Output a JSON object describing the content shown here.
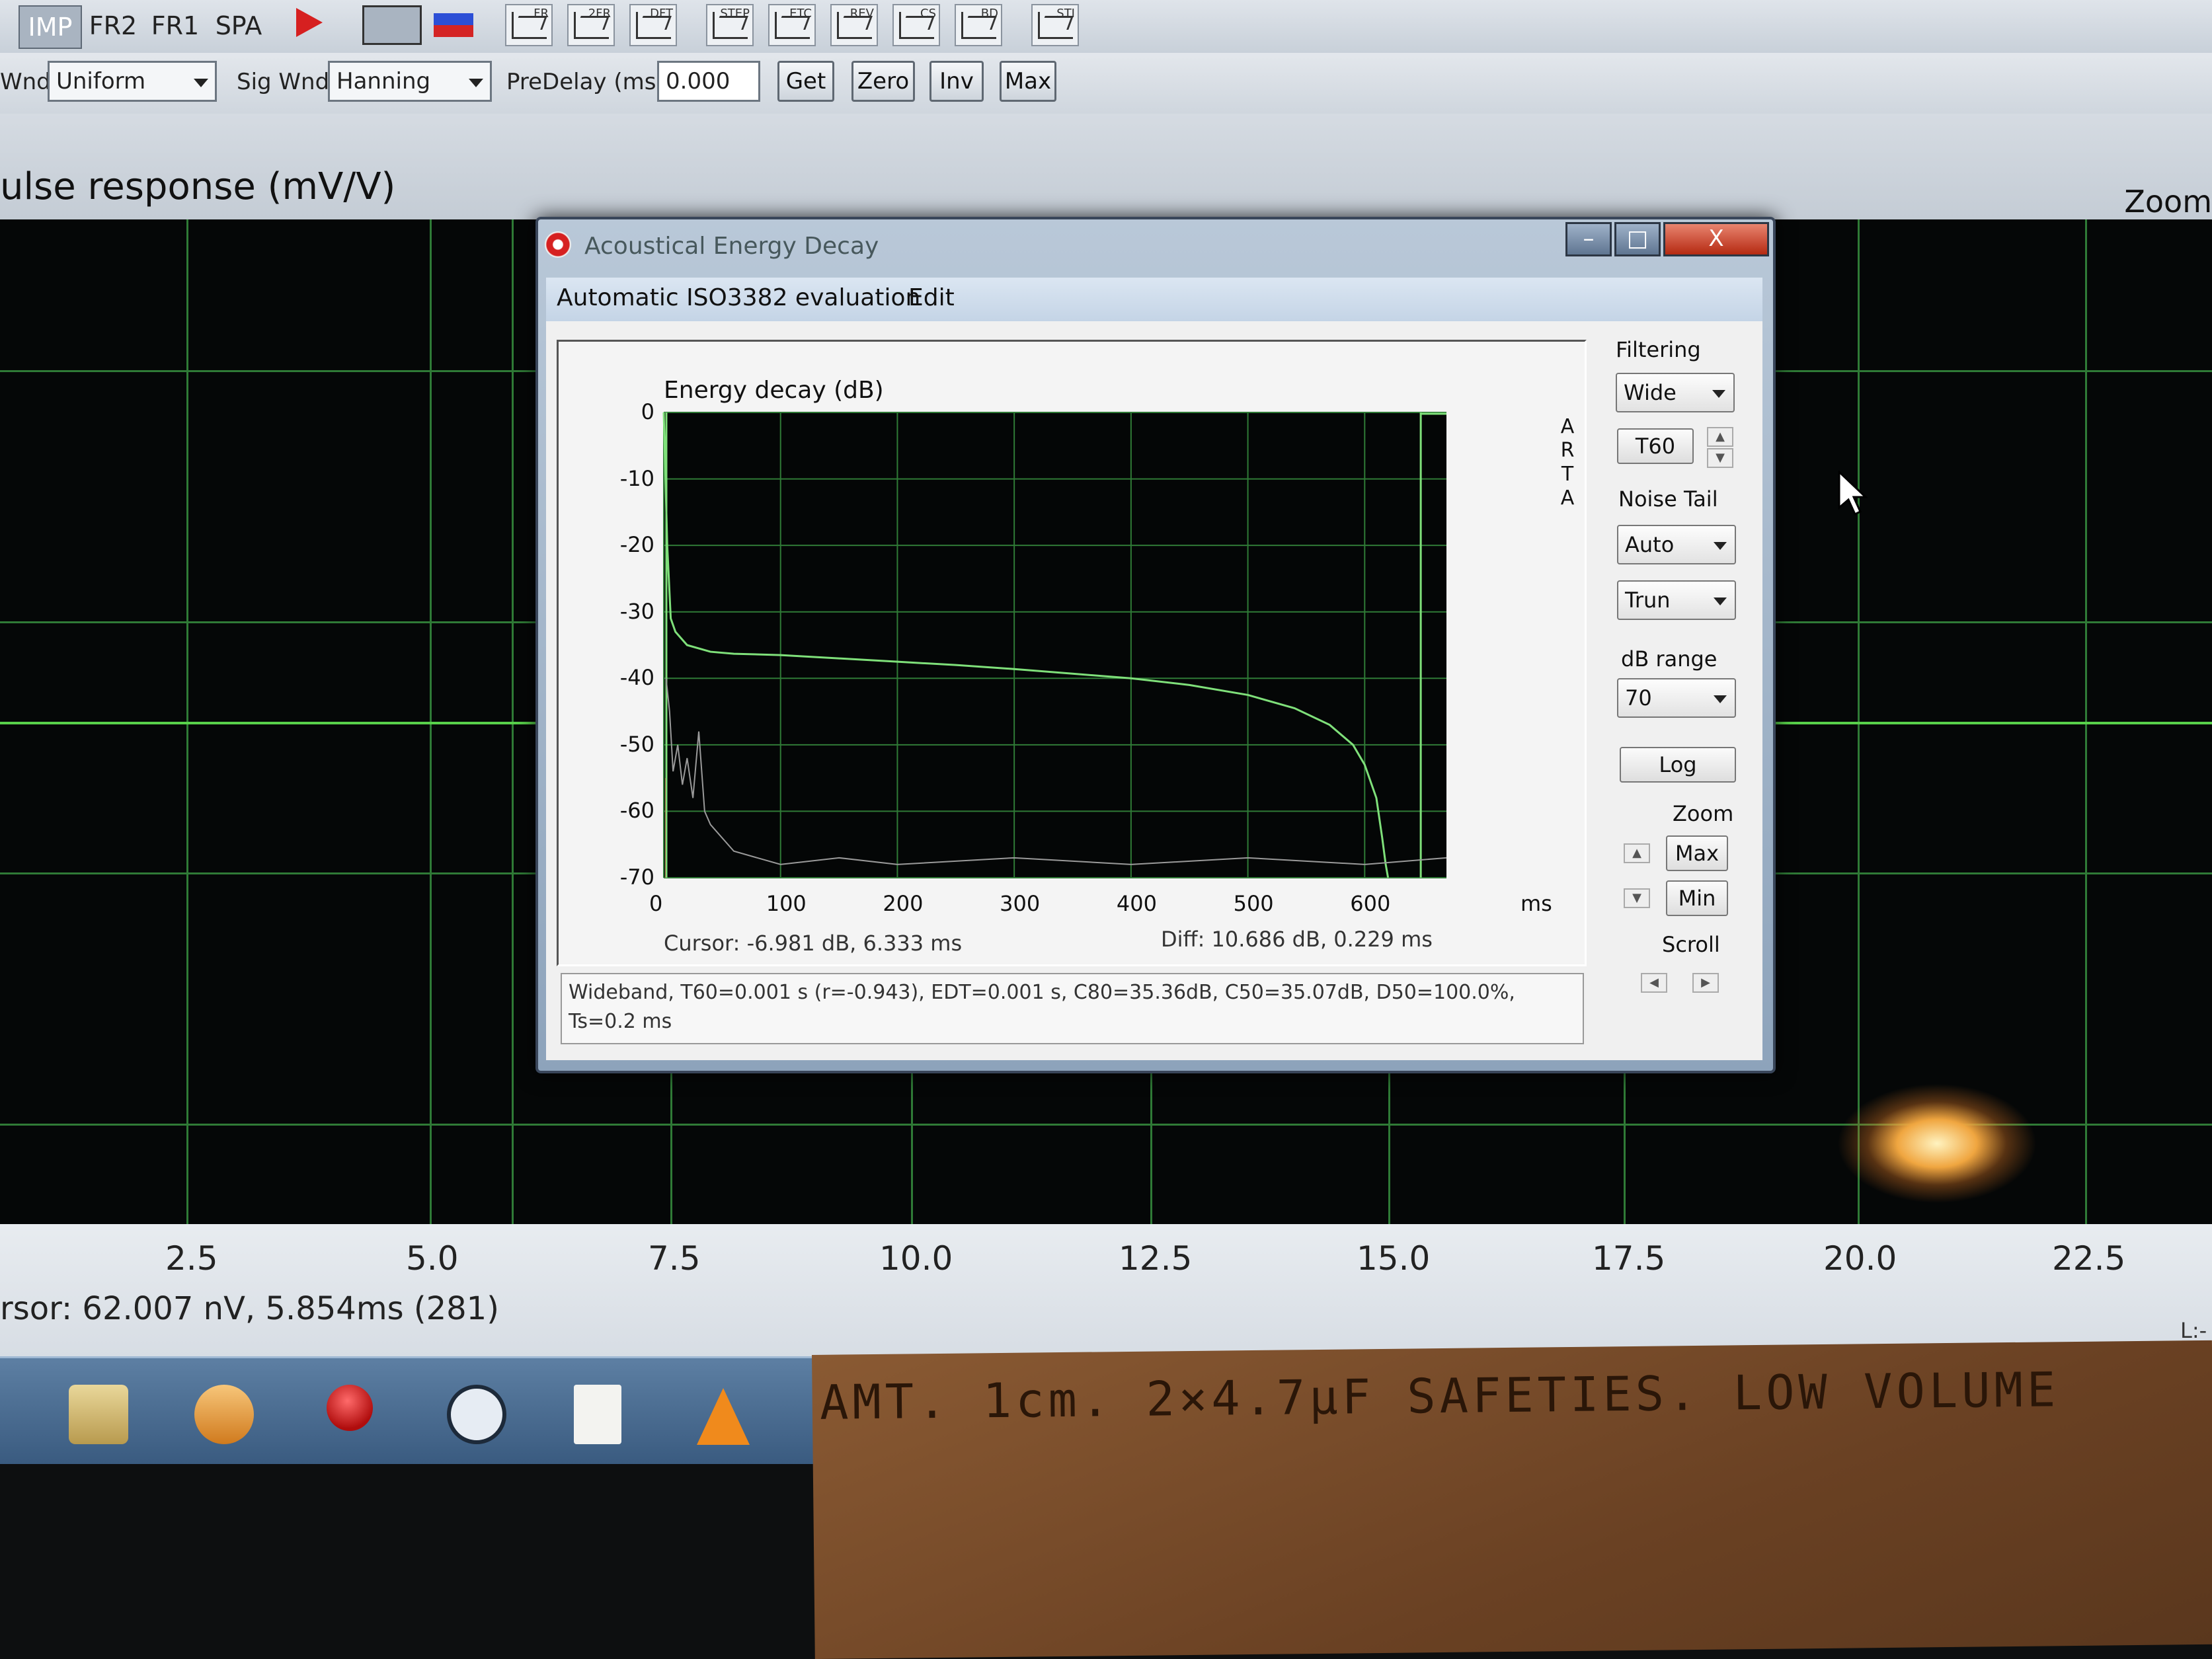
{
  "toolbar": {
    "mode_tabs": [
      "IMP",
      "FR2",
      "FR1",
      "SPA"
    ],
    "icon_tags": [
      "FR",
      "2FR",
      "DFT",
      "STEP",
      "ETC",
      "REV",
      "CS",
      "BD",
      "STI"
    ]
  },
  "settings_bar": {
    "wnd_label": "Wnd",
    "wnd_value": "Uniform",
    "sig_wnd_label": "Sig Wnd",
    "sig_wnd_value": "Hanning",
    "predelay_label": "PreDelay (ms)",
    "predelay_value": "0.000",
    "get_label": "Get",
    "zero_label": "Zero",
    "inv_label": "Inv",
    "max_label": "Max"
  },
  "main_plot": {
    "title": "ulse response (mV/V)",
    "zoom_label": "Zoom",
    "x_ticks": [
      "2.5",
      "5.0",
      "7.5",
      "10.0",
      "12.5",
      "15.0",
      "17.5",
      "20.0",
      "22.5"
    ],
    "cursor": "rsor: 62.007 nV, 5.854ms (281)",
    "corner": "L:-"
  },
  "dialog": {
    "title": "Acoustical Energy Decay",
    "minimize": "–",
    "maximize": "□",
    "close": "X",
    "menu": [
      "Automatic ISO3382 evaluation",
      "Edit"
    ],
    "filtering_label": "Filtering",
    "filtering_value": "Wide",
    "t60_label": "T60",
    "noise_tail_label": "Noise Tail",
    "noise_tail_value": "Auto",
    "trun_value": "Trun",
    "db_range_label": "dB range",
    "db_range_value": "70",
    "log_label": "Log",
    "zoom_label": "Zoom",
    "zoom_max": "Max",
    "zoom_min": "Min",
    "scroll_label": "Scroll",
    "cursor_text": "Cursor:  -6.981 dB,   6.333 ms",
    "diff_text": "Diff:   10.686 dB,    0.229 ms",
    "result_text": "Wideband, T60=0.001 s (r=-0.943), EDT=0.001 s, C80=35.36dB, C50=35.07dB, D50=100.0%, Ts=0.2 ms",
    "arta_letters": [
      "A",
      "R",
      "T",
      "A"
    ]
  },
  "chart_data": {
    "type": "line",
    "title": "Energy decay (dB)",
    "xlabel": "ms",
    "ylabel": "",
    "xlim": [
      0,
      670
    ],
    "ylim": [
      -70,
      0
    ],
    "x_ticks": [
      0,
      100,
      200,
      300,
      400,
      500,
      600
    ],
    "y_ticks": [
      0,
      -10,
      -20,
      -30,
      -40,
      -50,
      -60,
      -70
    ],
    "grid": true,
    "series": [
      {
        "color": "#7fe07a",
        "x": [
          0,
          3,
          6,
          10,
          20,
          40,
          60,
          100,
          150,
          200,
          250,
          300,
          350,
          400,
          450,
          500,
          540,
          570,
          590,
          600,
          610,
          615,
          618,
          620
        ],
        "y": [
          0,
          -20,
          -31,
          -33,
          -35,
          -36,
          -36.3,
          -36.5,
          -37,
          -37.5,
          -38,
          -38.6,
          -39.3,
          -40,
          -41,
          -42.5,
          -44.5,
          -47,
          -50,
          -53,
          -58,
          -64,
          -68,
          -70
        ]
      },
      {
        "color": "#9a9a9a",
        "x": [
          2,
          5,
          8,
          12,
          16,
          20,
          25,
          30,
          35,
          40,
          50,
          60,
          80,
          100,
          150,
          200,
          300,
          400,
          500,
          600,
          670
        ],
        "y": [
          -40,
          -45,
          -54,
          -50,
          -56,
          -52,
          -58,
          -48,
          -60,
          -62,
          -64,
          -66,
          -67,
          -68,
          -67,
          -68,
          -67,
          -68,
          -67,
          -68,
          -67
        ]
      }
    ]
  },
  "note": {
    "text": "AMT. 1cm. 2×4.7μF SAFETIES. LOW VOLUME"
  },
  "colors": {
    "grid_main": "#2f7a36",
    "trace": "#7fe07a",
    "noise_trace": "#9a9a9a",
    "marker_red": "#e01b1b"
  }
}
